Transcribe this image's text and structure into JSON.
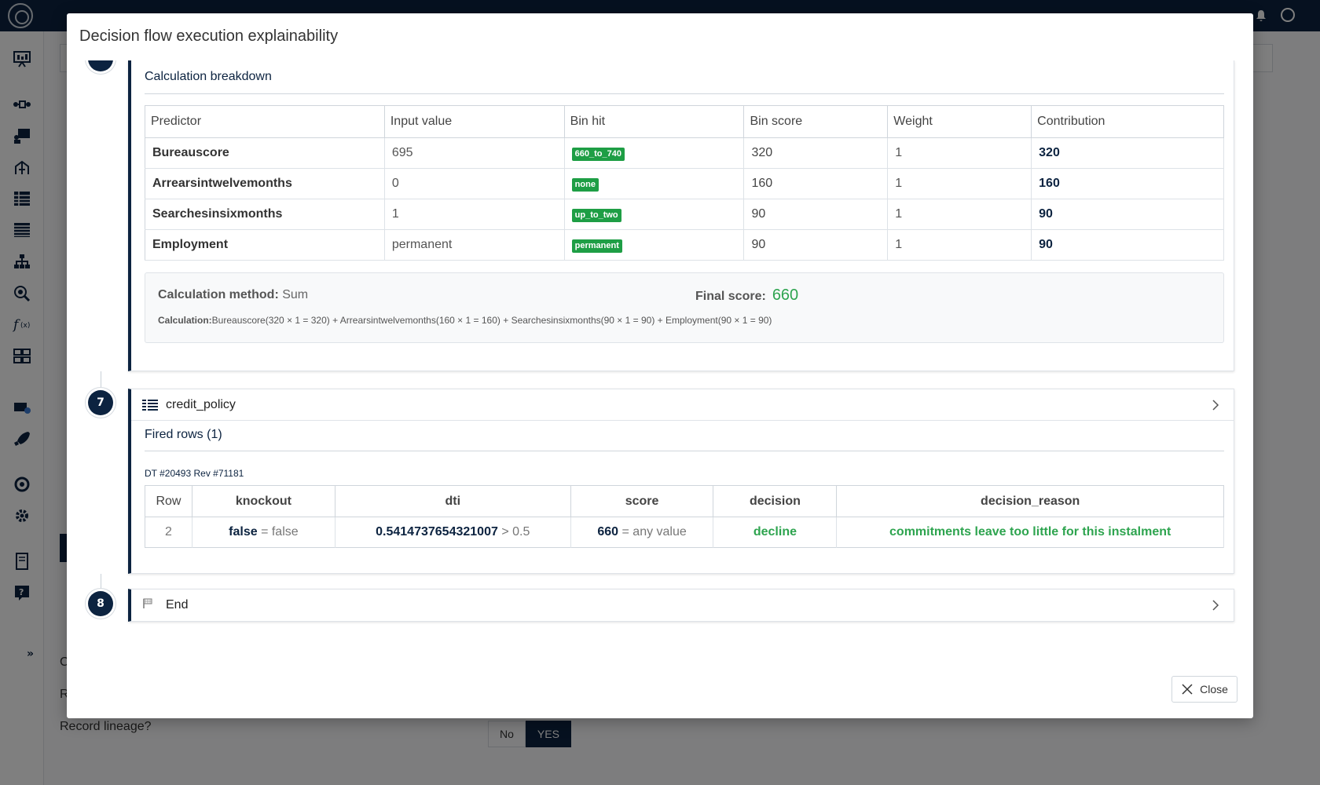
{
  "background": {
    "lineage_label": "Record lineage?",
    "lineage_options": [
      "No",
      "YES"
    ],
    "partial_labels": [
      "C",
      "R"
    ]
  },
  "modal": {
    "title": "Decision flow execution explainability",
    "close_label": "Close"
  },
  "scorecard_step": {
    "section_title": "Calculation breakdown",
    "columns": [
      "Predictor",
      "Input value",
      "Bin hit",
      "Bin score",
      "Weight",
      "Contribution"
    ],
    "rows": [
      {
        "predictor": "Bureauscore",
        "input": "695",
        "bin": "660_to_740",
        "bin_score": "320",
        "weight": "1",
        "contribution": "320"
      },
      {
        "predictor": "Arrearsintwelvemonths",
        "input": "0",
        "bin": "none",
        "bin_score": "160",
        "weight": "1",
        "contribution": "160"
      },
      {
        "predictor": "Searchesinsixmonths",
        "input": "1",
        "bin": "up_to_two",
        "bin_score": "90",
        "weight": "1",
        "contribution": "90"
      },
      {
        "predictor": "Employment",
        "input": "permanent",
        "bin": "permanent",
        "bin_score": "90",
        "weight": "1",
        "contribution": "90"
      }
    ],
    "method_label": "Calculation method:",
    "method_value": "Sum",
    "final_label": "Final score:",
    "final_value": "660",
    "formula_label": "Calculation:",
    "formula": "Bureauscore(320 × 1 = 320) + Arrearsintwelvemonths(160 × 1 = 160) + Searchesinsixmonths(90 × 1 = 90) + Employment(90 × 1 = 90)"
  },
  "step7": {
    "number": "7",
    "name": "credit_policy",
    "section_title": "Fired rows (1)",
    "dt_ref": "DT #20493 Rev #71181",
    "columns": [
      "Row",
      "knockout",
      "dti",
      "score",
      "decision",
      "decision_reason"
    ],
    "row": {
      "row": "2",
      "knockout_value": "false",
      "knockout_cond": "= false",
      "dti_value": "0.5414737654321007",
      "dti_cond": "> 0.5",
      "score_value": "660",
      "score_cond": "= any value",
      "decision": "decline",
      "decision_reason": "commitments leave too little for this instalment"
    }
  },
  "step8": {
    "number": "8",
    "name": "End"
  },
  "colors": {
    "navy": "#0c2340",
    "green": "#2ea44f",
    "badge_green": "#1e9e45"
  }
}
